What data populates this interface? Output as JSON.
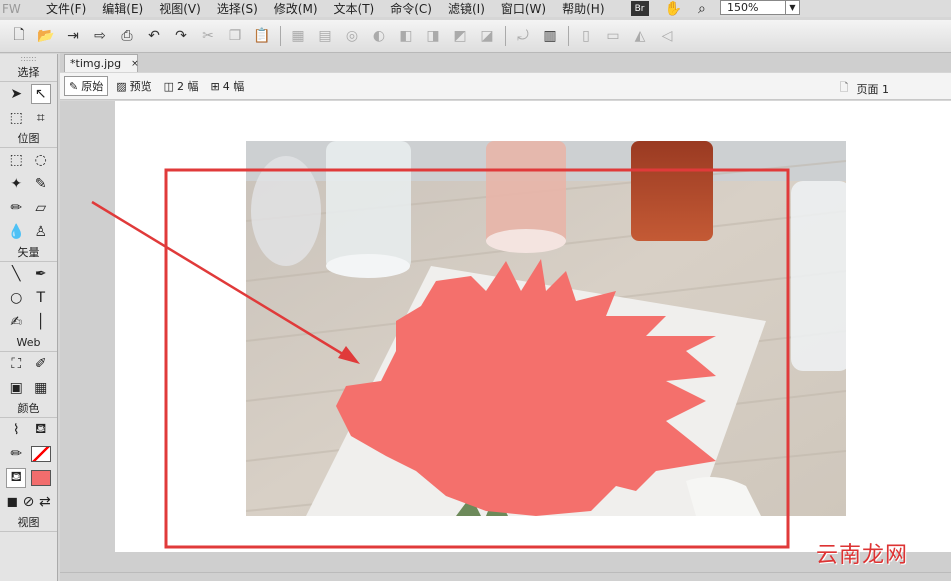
{
  "menubar": {
    "app_mark": "FW",
    "items": [
      "文件(F)",
      "编辑(E)",
      "视图(V)",
      "选择(S)",
      "修改(M)",
      "文本(T)",
      "命令(C)",
      "滤镜(I)",
      "窗口(W)",
      "帮助(H)"
    ],
    "bridge_label": "Br",
    "zoom": "150%"
  },
  "toolbar": {
    "icons": [
      "new-doc-icon",
      "open-icon",
      "import-icon",
      "export-icon",
      "print-icon",
      "undo-icon",
      "redo-icon"
    ]
  },
  "tools": {
    "sections": [
      "选择",
      "位图",
      "矢量",
      "Web",
      "颜色",
      "视图"
    ],
    "stroke_color": "#ff0000",
    "fill_color": "#f26d6d"
  },
  "document": {
    "tab_title": "*timg.jpg",
    "close_glyph": "×",
    "views": [
      "原始",
      "预览",
      "2 幅",
      "4 幅"
    ],
    "page_label": "页面 1"
  },
  "annotation": {
    "box_color": "#e03a3a",
    "blob_color": "#f4706c"
  },
  "watermark": "云南龙网"
}
